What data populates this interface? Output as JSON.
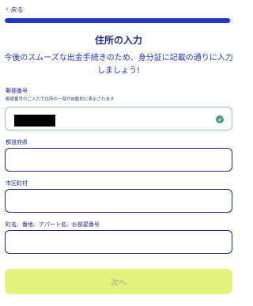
{
  "nav": {
    "back_label": "戻る"
  },
  "progress": {
    "value": 0.99
  },
  "header": {
    "title": "住所の入力",
    "subtitle_line1": "今後のスムーズな出金手続きのため、身分証に記載の通りに入力",
    "subtitle_line2": "しましょう!"
  },
  "form": {
    "postal": {
      "label": "郵便番号",
      "hint": "郵便番号のご入力で住所の一部が自動的に表示されます",
      "value": ""
    },
    "prefecture": {
      "label": "都道府県",
      "value": ""
    },
    "city": {
      "label": "市区町村",
      "value": ""
    },
    "address": {
      "label": "町名、番地、アパート名、お部屋番号",
      "value": ""
    }
  },
  "footer": {
    "next_label": "次へ"
  },
  "colors": {
    "accent": "#1f35c7",
    "button_bg": "#e3f27f",
    "valid_border": "#8fcfa0",
    "check": "#4c9a79"
  }
}
